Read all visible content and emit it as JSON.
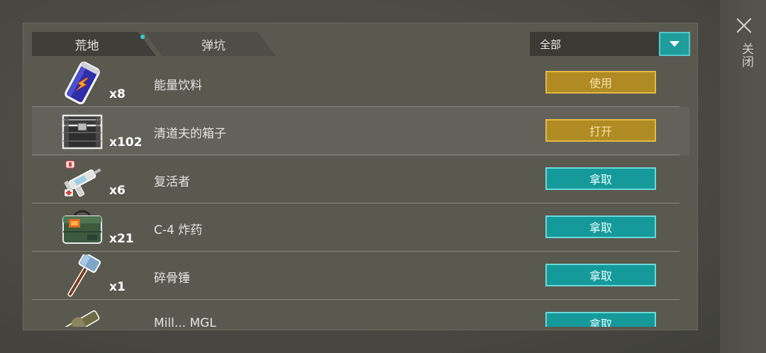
{
  "tabs": [
    {
      "label": "荒地",
      "has_notification_dot": true,
      "active": true
    },
    {
      "label": "弹坑",
      "active": false
    }
  ],
  "filter": {
    "selected": "全部"
  },
  "close": {
    "label": "关闭"
  },
  "items": [
    {
      "icon": "energy-drink-icon",
      "name": "能量饮料",
      "qty": "x8",
      "action": "使用",
      "action_style": "gold"
    },
    {
      "icon": "scavenger-box-icon",
      "name": "清道夫的箱子",
      "qty": "x102",
      "action": "打开",
      "action_style": "gold",
      "highlight": true
    },
    {
      "icon": "reviver-syringe-icon",
      "name": "复活者",
      "qty": "x6",
      "action": "拿取",
      "action_style": "teal"
    },
    {
      "icon": "c4-explosive-icon",
      "name": "C-4 炸药",
      "qty": "x21",
      "action": "拿取",
      "action_style": "teal"
    },
    {
      "icon": "bone-hammer-icon",
      "name": "碎骨锤",
      "qty": "x1",
      "action": "拿取",
      "action_style": "teal"
    },
    {
      "icon": "mill-mgl-icon",
      "name": "Mill... MGL",
      "qty": "",
      "action": "拿取",
      "action_style": "teal"
    }
  ],
  "colors": {
    "gold_button": "#b08a22",
    "teal_button": "#16999a",
    "accent_dot": "#2ed0d0"
  }
}
